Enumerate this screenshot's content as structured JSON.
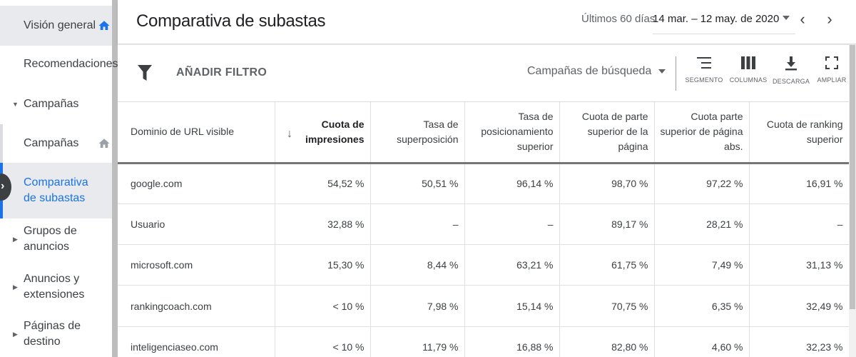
{
  "sidebar": {
    "items": [
      {
        "label": "Visión general"
      },
      {
        "label": "Recomendaciones"
      },
      {
        "label": "Campañas"
      },
      {
        "label": "Campañas"
      },
      {
        "label": "Comparativa de subastas"
      },
      {
        "label": "Grupos de anuncios"
      },
      {
        "label": "Anuncios y extensiones"
      },
      {
        "label": "Páginas de destino"
      }
    ]
  },
  "header": {
    "title": "Comparativa de subastas",
    "date_preset": "Últimos 60 días",
    "date_range": "14 mar. – 12 may. de 2020"
  },
  "toolbar": {
    "add_filter": "AÑADIR FILTRO",
    "campaign_filter": "Campañas de búsqueda",
    "tools": {
      "segment": "SEGMENTO",
      "columns": "COLUMNAS",
      "download": "DESCARGA",
      "expand": "AMPLIAR"
    }
  },
  "table": {
    "headers": [
      "Dominio de URL visible",
      "Cuota de impresiones",
      "Tasa de superposición",
      "Tasa de posicionamiento superior",
      "Cuota de parte superior de la página",
      "Cuota parte superior de página abs.",
      "Cuota de ranking superior"
    ],
    "rows": [
      [
        "google.com",
        "54,52 %",
        "50,51 %",
        "96,14 %",
        "98,70 %",
        "97,22 %",
        "16,91 %"
      ],
      [
        "Usuario",
        "32,88 %",
        "–",
        "–",
        "89,17 %",
        "28,21 %",
        "–"
      ],
      [
        "microsoft.com",
        "15,30 %",
        "8,44 %",
        "63,21 %",
        "61,75 %",
        "7,49 %",
        "31,13 %"
      ],
      [
        "rankingcoach.com",
        "< 10 %",
        "7,98 %",
        "15,14 %",
        "70,75 %",
        "6,35 %",
        "32,49 %"
      ],
      [
        "inteligenciaseo.com",
        "< 10 %",
        "11,79 %",
        "16,88 %",
        "82,80 %",
        "4,60 %",
        "32,23 %"
      ]
    ]
  },
  "colors": {
    "accent": "#1a73e8",
    "text": "#3c4043"
  }
}
